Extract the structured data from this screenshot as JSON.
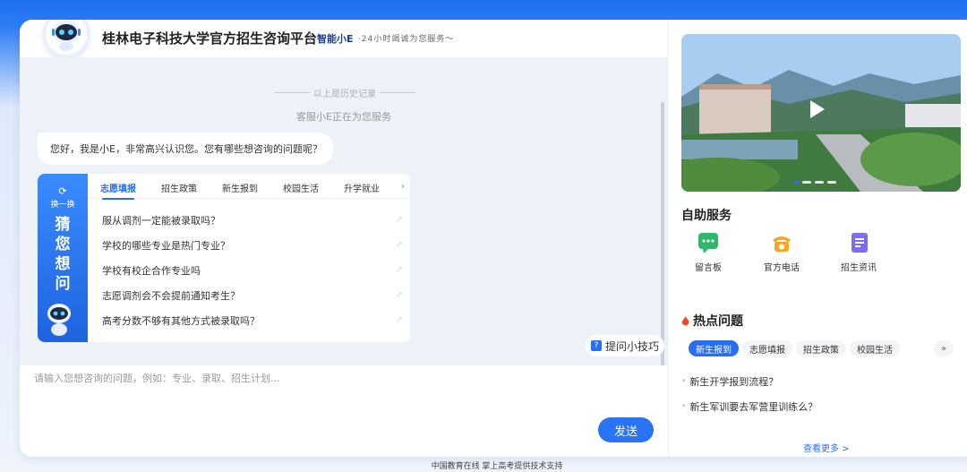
{
  "header": {
    "title": "桂林电子科技大学官方招生咨询平台",
    "brand": "智能小E",
    "slogan": "·24小时竭诚为您服务～"
  },
  "chat": {
    "history_label": "以上是历史记录",
    "service_status": "客服小E正在为您服务",
    "greeting": "您好，我是小E，非常高兴认识您。您有哪些想咨询的问题呢？",
    "qa_card": {
      "swap_label": "换一换",
      "side_title": [
        "猜",
        "您",
        "想",
        "问"
      ],
      "tabs": [
        "志愿填报",
        "招生政策",
        "新生报到",
        "校园生活",
        "升学就业"
      ],
      "active_tab": "志愿填报",
      "questions": [
        "服从调剂一定能被录取吗？",
        "学校的哪些专业是热门专业？",
        "学校有校企合作专业吗",
        "志愿调剂会不会提前通知考生？",
        "高考分数不够有其他方式被录取吗？"
      ]
    },
    "tips_label": "提问小技巧",
    "input_placeholder": "请输入您想咨询的问题，例如：专业、录取、招生计划...",
    "send_label": "发送"
  },
  "sidebar": {
    "self_service_title": "自助服务",
    "services": [
      {
        "label": "留言板",
        "icon": "message-board-icon",
        "color": "#2fb86b"
      },
      {
        "label": "官方电话",
        "icon": "phone-icon",
        "color": "#f5a623"
      },
      {
        "label": "招生资讯",
        "icon": "news-icon",
        "color": "#7b6cf0"
      }
    ],
    "hot_title": "热点问题",
    "hot_tabs": [
      "新生报到",
      "志愿填报",
      "招生政策",
      "校园生活"
    ],
    "hot_active_tab": "新生报到",
    "hot_questions": [
      "新生开学报到流程？",
      "新生军训要去军营里训练么？"
    ],
    "see_more": "查看更多 >"
  },
  "footer": {
    "text": "中国教育在线 掌上高考提供技术支持"
  },
  "colors": {
    "accent": "#2a6ef0",
    "background_top": "#1f6ff0"
  }
}
